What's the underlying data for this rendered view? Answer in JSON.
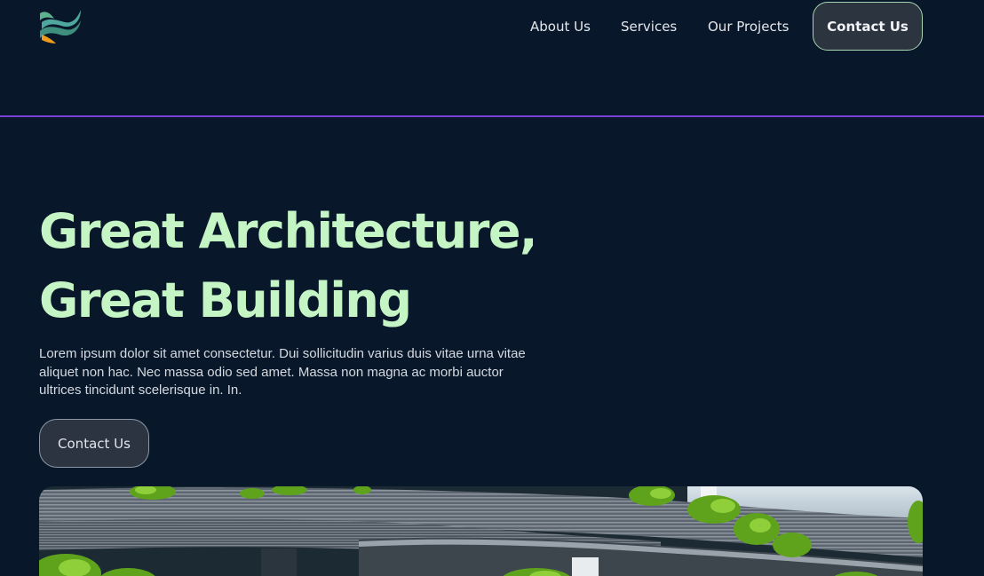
{
  "header": {
    "logo_icon": "wave-leaf-logo-icon",
    "nav": {
      "about": "About Us",
      "services": "Services",
      "projects": "Our Projects",
      "contact": "Contact Us"
    }
  },
  "hero": {
    "title_line1": "Great Architecture,",
    "title_line2": "Great Building",
    "description": "Lorem ipsum dolor sit amet consectetur. Dui sollicitudin varius duis vitae urna vitae aliquet non hac. Nec massa odio sed amet. Massa non magna ac morbi auctor ultrices tincidunt scelerisque in. In.",
    "cta_label": "Contact Us",
    "image_icon": "green-building-photo"
  },
  "colors": {
    "background": "#08182a",
    "accent_line": "#7a3fd6",
    "title": "#c6f5c5",
    "button_border": "#a7d6b2"
  }
}
